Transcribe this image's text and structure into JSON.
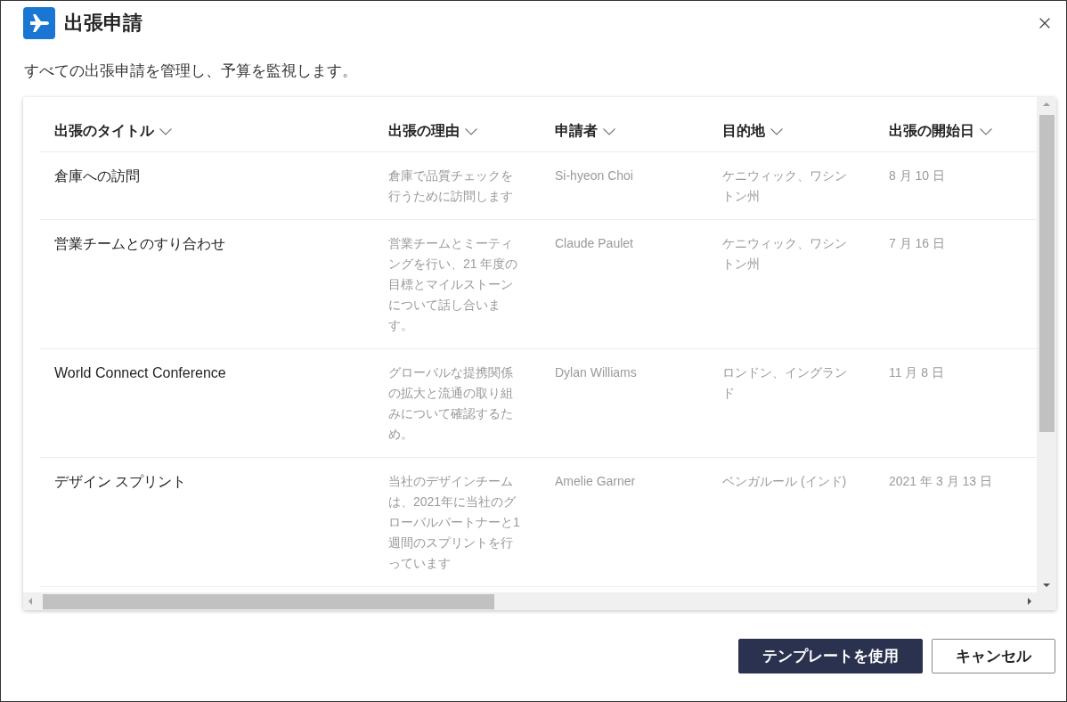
{
  "dialog": {
    "title": "出張申請",
    "description": "すべての出張申請を管理し、予算を監視します。"
  },
  "table": {
    "columns": [
      "出張のタイトル",
      "出張の理由",
      "申請者",
      "目的地",
      "出張の開始日"
    ],
    "rows": [
      {
        "title": "倉庫への訪問",
        "reason": "倉庫で品質チェックを行うために訪問します",
        "applicant": "Si-hyeon Choi",
        "destination": "ケニウィック、ワシントン州",
        "start_date": "8 月 10 日"
      },
      {
        "title": "営業チームとのすり合わせ",
        "reason": "営業チームとミーティングを行い、21 年度の目標とマイルストーンについて話し合います。",
        "applicant": "Claude Paulet",
        "destination": "ケニウィック、ワシントン州",
        "start_date": "7 月 16 日"
      },
      {
        "title": "World Connect Conference",
        "reason": "グローバルな提携関係の拡大と流通の取り組みについて確認するため。",
        "applicant": "Dylan Williams",
        "destination": "ロンドン、イングランド",
        "start_date": "11 月 8 日"
      },
      {
        "title": "デザイン スプリント",
        "reason": "当社のデザインチームは、2021年に当社のグローバルパートナーと1週間のスプリントを行っています",
        "applicant": "Amelie Garner",
        "destination": "ベンガルール (インド)",
        "start_date": "2021 年 3 月 13 日"
      }
    ]
  },
  "buttons": [
    {
      "label": "テンプレートを使用",
      "kind": "primary"
    },
    {
      "label": "キャンセル",
      "kind": "secondary"
    }
  ]
}
